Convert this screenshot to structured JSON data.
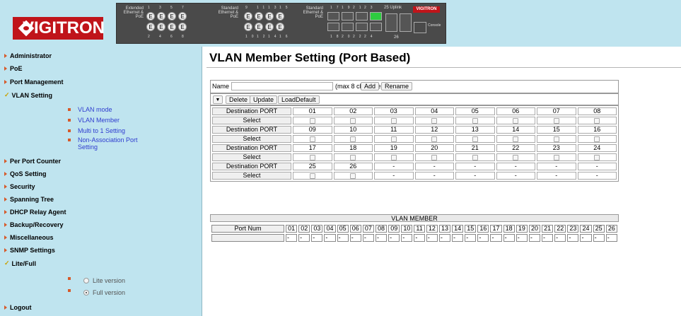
{
  "header": {
    "brand": "VIGITRON",
    "panel": {
      "group1_label": "Extended Ethernet & PoE",
      "group1_top_nums": [
        "1",
        "3",
        "5",
        "7"
      ],
      "group1_bottom_nums": [
        "2",
        "4",
        "6",
        "8"
      ],
      "group1_ports": [
        "E",
        "E",
        "E",
        "E",
        "E",
        "E",
        "E",
        "E"
      ],
      "group2_label": "Standard Ethernet & PoE",
      "group2_top_nums": [
        "9",
        "11",
        "13",
        "15"
      ],
      "group2_bottom_nums": [
        "10",
        "12",
        "14",
        "16"
      ],
      "group2_ports": [
        "E",
        "E",
        "E",
        "E",
        "E",
        "E",
        "E",
        "E"
      ],
      "group3_label": "Standard Ethernet & PoE",
      "group3_top_nums": [
        "17",
        "19",
        "21",
        "23"
      ],
      "group3_bottom_nums": [
        "18",
        "20",
        "22",
        "24"
      ],
      "uplink_label": "Uplink",
      "uplink_nums": [
        "25",
        "26"
      ],
      "console_label": "Console",
      "mini_brand": "VIGITRON"
    }
  },
  "sidebar": {
    "items": [
      {
        "label": "Administrator",
        "icon": "arrow-icon"
      },
      {
        "label": "PoE",
        "icon": "arrow-icon"
      },
      {
        "label": "Port Management",
        "icon": "arrow-icon"
      },
      {
        "label": "VLAN Setting",
        "icon": "check-icon"
      },
      {
        "label": "Per Port Counter",
        "icon": "arrow-icon"
      },
      {
        "label": "QoS Setting",
        "icon": "arrow-icon"
      },
      {
        "label": "Security",
        "icon": "arrow-icon"
      },
      {
        "label": "Spanning Tree",
        "icon": "arrow-icon"
      },
      {
        "label": "DHCP Relay Agent",
        "icon": "arrow-icon"
      },
      {
        "label": "Backup/Recovery",
        "icon": "arrow-icon"
      },
      {
        "label": "Miscellaneous",
        "icon": "arrow-icon"
      },
      {
        "label": "SNMP Settings",
        "icon": "arrow-icon"
      },
      {
        "label": "Lite/Full",
        "icon": "check-icon"
      },
      {
        "label": "Logout",
        "icon": "arrow-icon"
      }
    ],
    "vlan_sub": [
      "VLAN mode",
      "VLAN Member",
      "Multi to 1 Setting",
      "Non-Association Port Setting"
    ],
    "lite_full": {
      "options": [
        "Lite version",
        "Full version"
      ],
      "selected": "Full version"
    }
  },
  "main": {
    "title": "VLAN Member Setting (Port Based)",
    "name_label": "Name",
    "name_value": "",
    "name_hint": "(max 8 characters)",
    "add_label": "Add",
    "rename_label": "Rename",
    "select_value": "",
    "delete_label": "Delete",
    "update_label": "Update",
    "loaddefault_label": "LoadDefault",
    "dest_label": "Destination PORT",
    "select_label": "Select",
    "port_rows": [
      [
        "01",
        "02",
        "03",
        "04",
        "05",
        "06",
        "07",
        "08"
      ],
      [
        "09",
        "10",
        "11",
        "12",
        "13",
        "14",
        "15",
        "16"
      ],
      [
        "17",
        "18",
        "19",
        "20",
        "21",
        "22",
        "23",
        "24"
      ],
      [
        "25",
        "26",
        "-",
        "-",
        "-",
        "-",
        "-",
        "-"
      ]
    ],
    "vlan_member": {
      "title": "VLAN MEMBER",
      "port_num_label": "Port Num",
      "ports": [
        "01",
        "02",
        "03",
        "04",
        "05",
        "06",
        "07",
        "08",
        "09",
        "10",
        "11",
        "12",
        "13",
        "14",
        "15",
        "16",
        "17",
        "18",
        "19",
        "20",
        "21",
        "22",
        "23",
        "24",
        "25",
        "26"
      ],
      "values": [
        "-",
        "-",
        "-",
        "-",
        "-",
        "-",
        "-",
        "-",
        "-",
        "-",
        "-",
        "-",
        "-",
        "-",
        "-",
        "-",
        "-",
        "-",
        "-",
        "-",
        "-",
        "-",
        "-",
        "-",
        "-",
        "-"
      ]
    }
  }
}
